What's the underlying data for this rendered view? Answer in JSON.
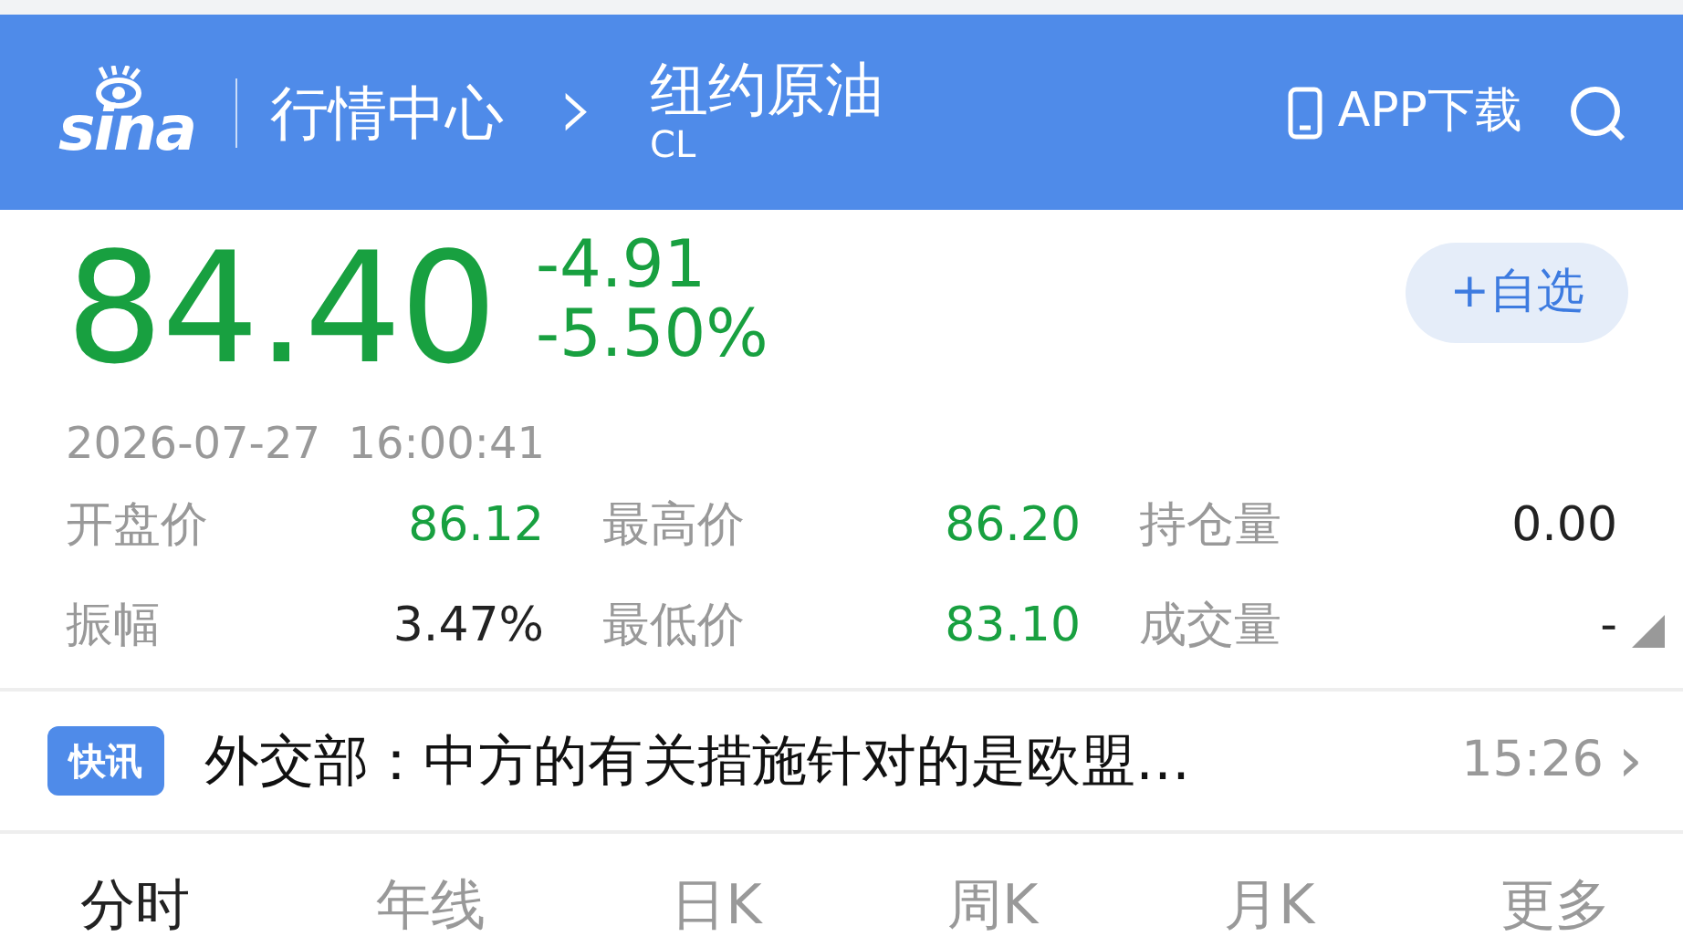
{
  "header": {
    "logo": "sina",
    "section": "行情中心",
    "separator": "›",
    "title": "纽约原油",
    "code": "CL",
    "app_download": "APP下载"
  },
  "quote": {
    "price": "84.40",
    "change": "-4.91",
    "change_pct": "-5.50%",
    "color": "#18a040",
    "watch_button": "+自选",
    "timestamp": "2026-07-27  16:00:41"
  },
  "stats": [
    {
      "label": "开盘价",
      "value": "86.12",
      "color": "#18a040"
    },
    {
      "label": "最高价",
      "value": "86.20",
      "color": "#18a040"
    },
    {
      "label": "持仓量",
      "value": "0.00",
      "color": "#222222"
    },
    {
      "label": "振幅",
      "value": "3.47%",
      "color": "#222222"
    },
    {
      "label": "最低价",
      "value": "83.10",
      "color": "#18a040"
    },
    {
      "label": "成交量",
      "value": "-",
      "color": "#222222"
    }
  ],
  "news": {
    "badge": "快讯",
    "headline": "外交部：中方的有关措施针对的是欧盟…",
    "time": "15:26",
    "arrow": "›"
  },
  "tabs": [
    {
      "label": "分时",
      "selected": true
    },
    {
      "label": "年线",
      "selected": false
    },
    {
      "label": "日K",
      "selected": false
    },
    {
      "label": "周K",
      "selected": false
    },
    {
      "label": "月K",
      "selected": false
    },
    {
      "label": "更多",
      "selected": false
    }
  ]
}
